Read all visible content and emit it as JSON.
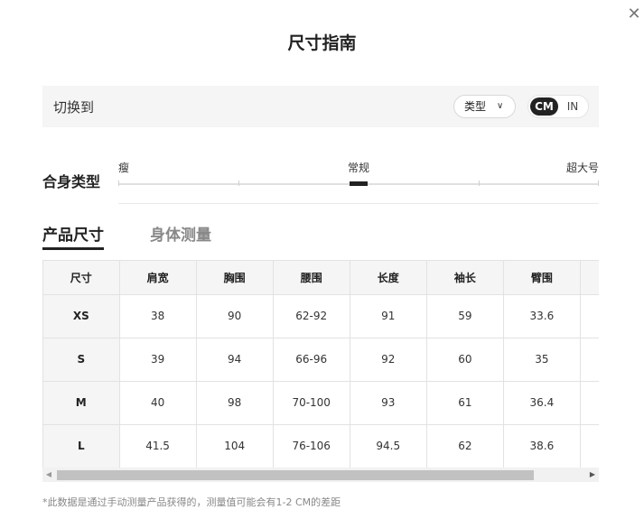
{
  "dialog": {
    "title": "尺寸指南",
    "close_icon": "close-icon"
  },
  "switch": {
    "label": "切换到",
    "type_select": {
      "value": "类型",
      "icon": "chevron-down-icon"
    },
    "units": {
      "cm": "CM",
      "in": "IN",
      "selected": "CM"
    }
  },
  "fit": {
    "label": "合身类型",
    "ticks": [
      "瘦",
      "常规",
      "超大号"
    ],
    "selected": "常规"
  },
  "tabs": {
    "product": "产品尺寸",
    "body": "身体测量",
    "active": "产品尺寸"
  },
  "table": {
    "headers": [
      "尺寸",
      "肩宽",
      "胸围",
      "腰围",
      "长度",
      "袖长",
      "臂围",
      ""
    ],
    "rows": [
      [
        "XS",
        "38",
        "90",
        "62-92",
        "91",
        "59",
        "33.6",
        ""
      ],
      [
        "S",
        "39",
        "94",
        "66-96",
        "92",
        "60",
        "35",
        ""
      ],
      [
        "M",
        "40",
        "98",
        "70-100",
        "93",
        "61",
        "36.4",
        ""
      ],
      [
        "L",
        "41.5",
        "104",
        "76-106",
        "94.5",
        "62",
        "38.6",
        ""
      ],
      [
        "",
        "",
        "",
        "",
        "",
        "",
        "",
        ""
      ]
    ]
  },
  "scrollbar": {
    "left_icon": "scroll-left-arrow-icon",
    "right_icon": "scroll-right-arrow-icon"
  },
  "footnote": "*此数据是通过手动测量产品获得的，测量值可能会有1-2 CM的差距"
}
